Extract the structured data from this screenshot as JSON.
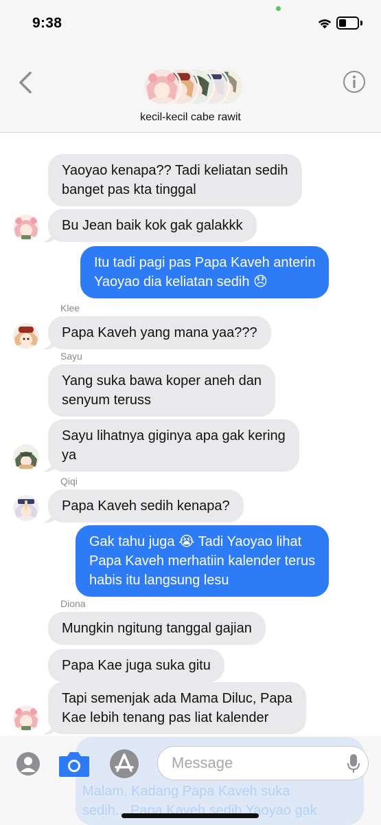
{
  "status_bar": {
    "time": "9:38"
  },
  "header": {
    "group_name": "kecil-kecil cabe rawit",
    "back_icon": "chevron-left-icon",
    "info_icon": "info-icon"
  },
  "messages": [
    {
      "sender": "",
      "text_lines": [
        "Yaoyao kenapa?? Tadi keliatan sedih",
        "banget pas kta tinggal"
      ],
      "direction": "in"
    },
    {
      "sender": "",
      "text_lines": [
        "Bu Jean baik kok gak galakkk"
      ],
      "direction": "in",
      "avatar": "yaoyao"
    },
    {
      "sender": "",
      "text_lines": [
        "Itu tadi pagi pas Papa Kaveh anterin",
        "Yaoyao dia keliatan sedih 😞"
      ],
      "direction": "out"
    },
    {
      "sender": "Klee",
      "text_lines": [
        "Papa Kaveh yang mana yaa???"
      ],
      "direction": "in",
      "avatar": "klee"
    },
    {
      "sender": "Sayu",
      "text_lines": [
        "Yang suka bawa koper aneh dan",
        "senyum teruss"
      ],
      "direction": "in"
    },
    {
      "sender": "",
      "text_lines": [
        "Sayu lihatnya giginya apa gak kering",
        "ya"
      ],
      "direction": "in",
      "avatar": "sayu"
    },
    {
      "sender": "Qiqi",
      "text_lines": [
        "Papa Kaveh sedih kenapa?"
      ],
      "direction": "in",
      "avatar": "qiqi"
    },
    {
      "sender": "",
      "text_lines": [
        "Gak tahu juga 😭 Tadi Yaoyao lihat",
        "Papa Kaveh merhatiin kalender terus",
        "habis itu langsung lesu"
      ],
      "direction": "out"
    },
    {
      "sender": "Diona",
      "text_lines": [
        "Mungkin ngitung tanggal gajian"
      ],
      "direction": "in"
    },
    {
      "sender": "",
      "text_lines": [
        "Papa Kae juga suka gitu"
      ],
      "direction": "in"
    },
    {
      "sender": "",
      "text_lines": [
        "Tapi semenjak ada Mama Diluc, Papa",
        "Kae lebih tenang pas liat kalender"
      ],
      "direction": "in",
      "avatar": "yaoyao"
    }
  ],
  "input_bar": {
    "placeholder": "Message",
    "ghost_lines": [
      "Malam. Kadang Papa Kaveh suka",
      "sedih... Papa Kaveh sedih Yaoyao gak"
    ]
  },
  "colors": {
    "outgoing_bubble": "#2d7cf6",
    "incoming_bubble": "#e9e9eb",
    "header_bg": "#f6f6f6",
    "accent": "#2d7cf6"
  }
}
